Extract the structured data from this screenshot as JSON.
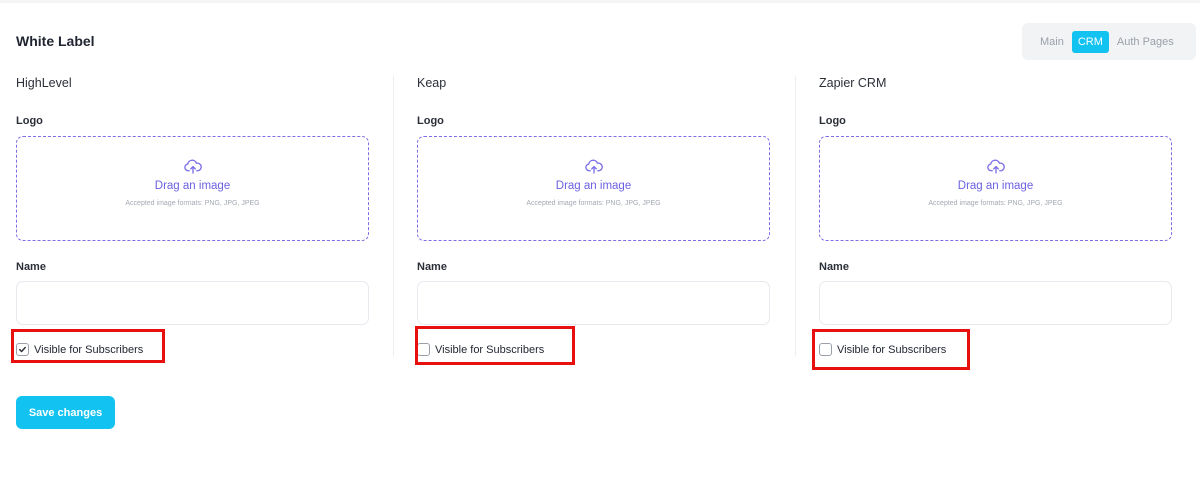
{
  "page": {
    "title": "White Label"
  },
  "tabs": [
    {
      "label": "Main",
      "active": false
    },
    {
      "label": "CRM",
      "active": true
    },
    {
      "label": "Auth Pages",
      "active": false
    }
  ],
  "crms": [
    {
      "title": "HighLevel",
      "logo_label": "Logo",
      "dropzone_text": "Drag an image",
      "dropzone_hint": "Accepted image formats: PNG, JPG, JPEG",
      "name_label": "Name",
      "name_value": "",
      "visible_label": "Visible for Subscribers",
      "visible_checked": true
    },
    {
      "title": "Keap",
      "logo_label": "Logo",
      "dropzone_text": "Drag an image",
      "dropzone_hint": "Accepted image formats: PNG, JPG, JPEG",
      "name_label": "Name",
      "name_value": "",
      "visible_label": "Visible for Subscribers",
      "visible_checked": false
    },
    {
      "title": "Zapier CRM",
      "logo_label": "Logo",
      "dropzone_text": "Drag an image",
      "dropzone_hint": "Accepted image formats: PNG, JPG, JPEG",
      "name_label": "Name",
      "name_value": "",
      "visible_label": "Visible for Subscribers",
      "visible_checked": false
    }
  ],
  "actions": {
    "save_label": "Save changes"
  },
  "colors": {
    "accent": "#12c2f1",
    "dropzone": "#7b6ee6",
    "highlight": "#e8100f"
  },
  "icons": {
    "dropzone": "cloud-upload-icon",
    "checked": "checkmark-icon"
  }
}
